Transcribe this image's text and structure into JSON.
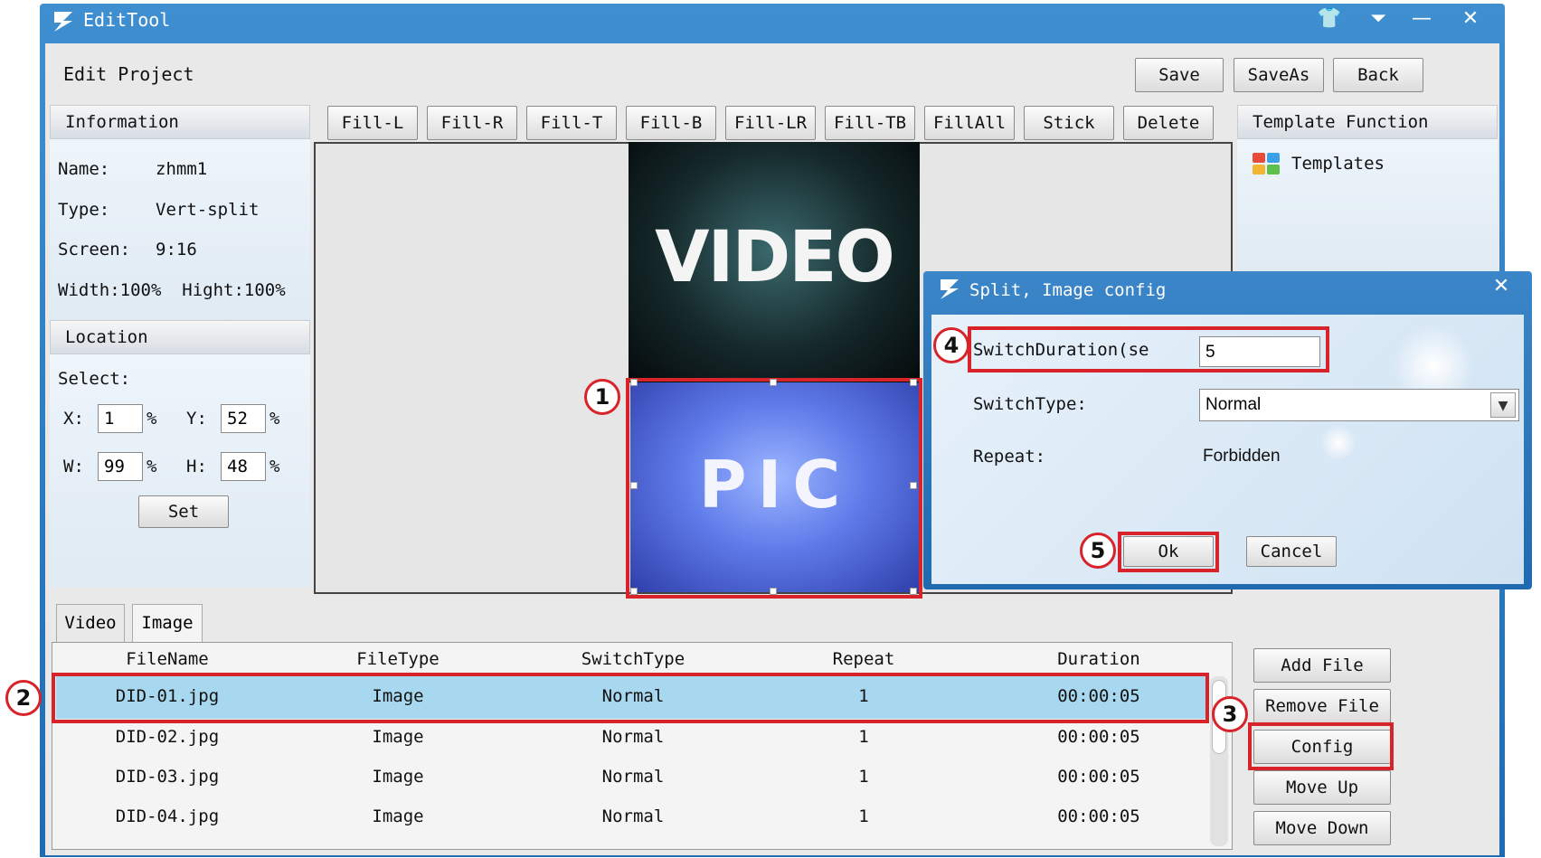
{
  "app": {
    "title": "EditTool"
  },
  "header": {
    "label": "Edit Project",
    "save": "Save",
    "save_as": "SaveAs",
    "back": "Back"
  },
  "fill_toolbar": [
    "Fill-L",
    "Fill-R",
    "Fill-T",
    "Fill-B",
    "Fill-LR",
    "Fill-TB",
    "FillAll",
    "Stick",
    "Delete"
  ],
  "information": {
    "title": "Information",
    "name_label": "Name:",
    "name_value": "zhmm1",
    "type_label": "Type:",
    "type_value": "Vert-split",
    "screen_label": "Screen:",
    "screen_value": "9:16",
    "size_text": "Width:100%  Hight:100%"
  },
  "location": {
    "title": "Location",
    "select_label": "Select:",
    "x_label": "X:",
    "x_value": "1",
    "y_label": "Y:",
    "y_value": "52",
    "w_label": "W:",
    "w_value": "99",
    "h_label": "H:",
    "h_value": "48",
    "pct": "%",
    "set_button": "Set"
  },
  "template_function": {
    "title": "Template Function",
    "templates_label": "Templates"
  },
  "preview": {
    "video_text": "VIDEO",
    "pic_text": "PIC"
  },
  "tabs": [
    "Video",
    "Image"
  ],
  "table": {
    "headers": [
      "FileName",
      "FileType",
      "SwitchType",
      "Repeat",
      "Duration"
    ],
    "rows": [
      [
        "DID-01.jpg",
        "Image",
        "Normal",
        "1",
        "00:00:05"
      ],
      [
        "DID-02.jpg",
        "Image",
        "Normal",
        "1",
        "00:00:05"
      ],
      [
        "DID-03.jpg",
        "Image",
        "Normal",
        "1",
        "00:00:05"
      ],
      [
        "DID-04.jpg",
        "Image",
        "Normal",
        "1",
        "00:00:05"
      ]
    ]
  },
  "file_buttons": {
    "add": "Add File",
    "remove": "Remove File",
    "config": "Config",
    "move_up": "Move Up",
    "move_down": "Move Down"
  },
  "dialog": {
    "title": "Split, Image config",
    "switch_duration_label": "SwitchDuration(se",
    "switch_duration_value": "5",
    "switch_type_label": "SwitchType:",
    "switch_type_value": "Normal",
    "repeat_label": "Repeat:",
    "repeat_value": "Forbidden",
    "ok": "Ok",
    "cancel": "Cancel"
  },
  "markers": [
    "1",
    "2",
    "3",
    "4",
    "5"
  ],
  "colors": {
    "title_bar": "#2a78be",
    "highlight": "#d8232a",
    "selected_row": "#a8d8ef"
  }
}
